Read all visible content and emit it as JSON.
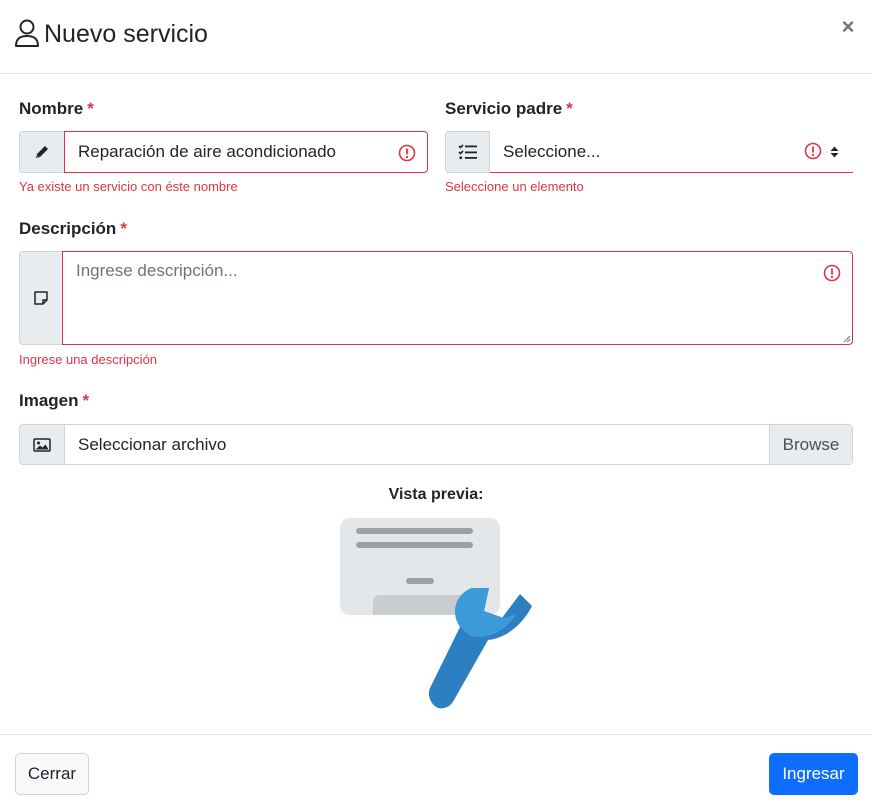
{
  "header": {
    "title": "Nuevo servicio",
    "close_label": "×"
  },
  "form": {
    "nombre": {
      "label": "Nombre",
      "required_mark": "*",
      "value": "Reparación de aire acondicionado",
      "error": "Ya existe un servicio con éste nombre",
      "icon": "pencil-icon"
    },
    "servicio_padre": {
      "label": "Servicio padre",
      "required_mark": "*",
      "selected": "Seleccione...",
      "error": "Seleccione un elemento",
      "icon": "list-check-icon"
    },
    "descripcion": {
      "label": "Descripción",
      "required_mark": "*",
      "placeholder": "Ingrese descripción...",
      "error": "Ingrese una descripción",
      "icon": "sticky-note-icon"
    },
    "imagen": {
      "label": "Imagen",
      "required_mark": "*",
      "file_text": "Seleccionar archivo",
      "browse_label": "Browse",
      "icon": "image-icon"
    },
    "preview_label": "Vista previa:"
  },
  "footer": {
    "close_label": "Cerrar",
    "submit_label": "Ingresar"
  },
  "colors": {
    "primary": "#0d6efd",
    "danger": "#dc3545",
    "border": "#ced4da",
    "addon_bg": "#e9ecef"
  }
}
